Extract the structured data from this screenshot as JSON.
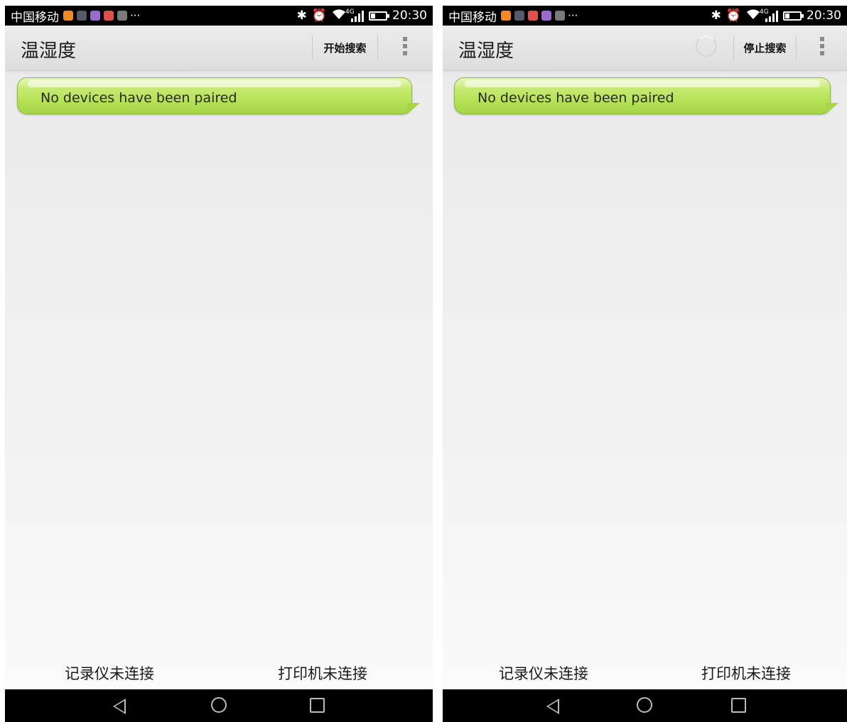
{
  "screens": [
    {
      "status_bar": {
        "carrier": "中国移动",
        "more_indicator": "···",
        "network": "4G",
        "time": "20:30",
        "notification_icon_colors": [
          "#f08a24",
          "#555a66",
          "#9a6ad0",
          "#e0504a",
          "#7a7a7a"
        ],
        "status_icons": [
          "bluetooth-icon",
          "alarm-icon",
          "wifi-icon",
          "signal-icon",
          "battery-icon"
        ]
      },
      "action_bar": {
        "title": "温湿度",
        "action_label": "开始搜索",
        "menu_icon": "overflow-menu-icon",
        "searching": false
      },
      "message": "No devices have been paired",
      "bottom": {
        "recorder_status": "记录仪未连接",
        "printer_status": "打印机未连接"
      }
    },
    {
      "status_bar": {
        "carrier": "中国移动",
        "more_indicator": "···",
        "network": "4G",
        "time": "20:30",
        "notification_icon_colors": [
          "#f08a24",
          "#555a66",
          "#e0504a",
          "#9a6ad0",
          "#7a7a7a"
        ],
        "status_icons": [
          "bluetooth-icon",
          "alarm-icon",
          "wifi-icon",
          "signal-icon",
          "battery-icon"
        ]
      },
      "action_bar": {
        "title": "温湿度",
        "action_label": "停止搜索",
        "menu_icon": "overflow-menu-icon",
        "searching": true
      },
      "message": "No devices have been paired",
      "bottom": {
        "recorder_status": "记录仪未连接",
        "printer_status": "打印机未连接"
      }
    }
  ],
  "nav_bar_icons": [
    "back-icon",
    "home-icon",
    "recent-apps-icon"
  ],
  "colors": {
    "bubble_green": "#b2e052",
    "bar_black": "#000000"
  }
}
